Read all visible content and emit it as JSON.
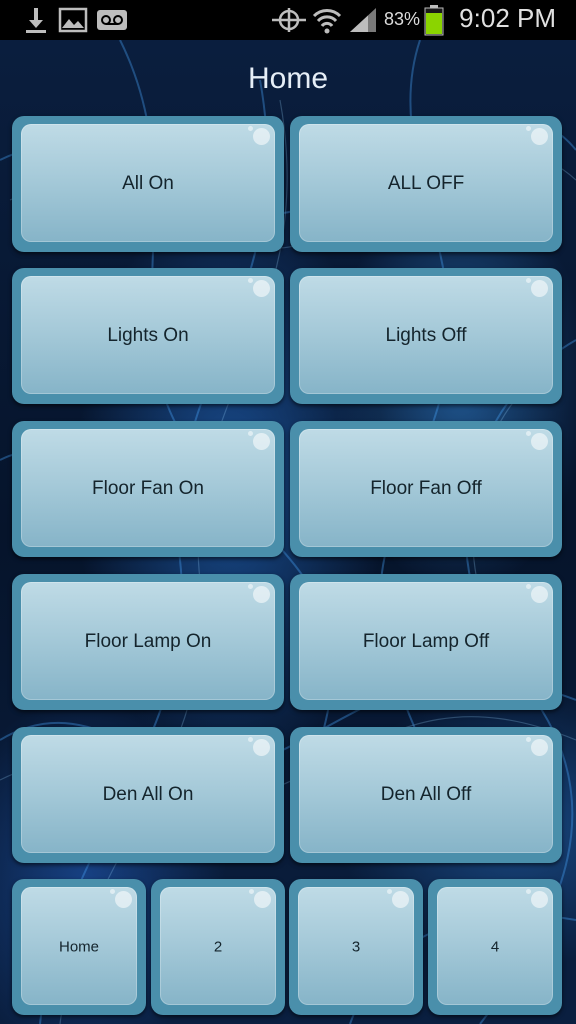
{
  "status_bar": {
    "battery_percent": "83%",
    "time": "9:02 PM",
    "icons": [
      "download-icon",
      "image-icon",
      "voicemail-icon",
      "location-icon",
      "wifi-icon",
      "signal-icon",
      "battery-icon"
    ]
  },
  "page": {
    "title": "Home"
  },
  "buttons": [
    {
      "label": "All On"
    },
    {
      "label": "ALL OFF"
    },
    {
      "label": "Lights On"
    },
    {
      "label": "Lights Off"
    },
    {
      "label": "Floor Fan On"
    },
    {
      "label": "Floor Fan Off"
    },
    {
      "label": "Floor Lamp On"
    },
    {
      "label": "Floor Lamp Off"
    },
    {
      "label": "Den All On"
    },
    {
      "label": "Den All Off"
    }
  ],
  "tabs": [
    {
      "label": "Home"
    },
    {
      "label": "2"
    },
    {
      "label": "3"
    },
    {
      "label": "4"
    }
  ],
  "colors": {
    "button_frame": "#4a8fab",
    "button_face": "#a6cad9",
    "background": "#0a1e3e",
    "text_dark": "#14242c"
  }
}
